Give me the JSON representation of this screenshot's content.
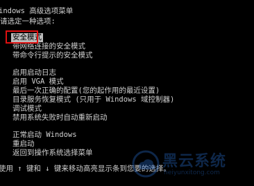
{
  "boot_menu": {
    "title": "indows 高级选项菜单",
    "prompt": "请选定一种选项:",
    "groups": [
      {
        "items": [
          "安全模式",
          "带网络连接的安全模式",
          "带命令行提示的安全模式"
        ]
      },
      {
        "items": [
          "启用启动日志",
          "启用 VGA 模式",
          "最后一次正确的配置(您的起作用的最近设置)",
          "目录服务恢复模式 (只用于 Windows 域控制器)",
          "调试模式",
          "禁用系统失败时自动重新启动"
        ]
      },
      {
        "items": [
          "正常启动 Windows",
          "重启动",
          "返回到操作系统选择菜单"
        ]
      }
    ],
    "selected_index": 0,
    "footer": "使用 ↑ 键和 ↓ 键来移动高亮显示条到您要的选择。"
  },
  "watermark": {
    "brand": "黑云系统",
    "url": "heiyunxitong.com"
  },
  "colors": {
    "background": "#000000",
    "text": "#cfcfcf",
    "selection_bg": "#bdbdbd",
    "annotation": "#e01010",
    "watermark": "#2a6fd0"
  }
}
